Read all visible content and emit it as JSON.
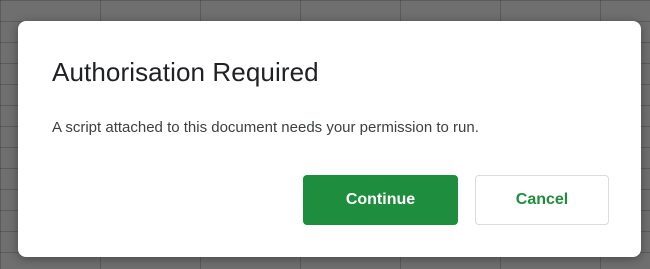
{
  "dialog": {
    "title": "Authorisation Required",
    "message": "A script attached to this document needs your permission to run.",
    "buttons": {
      "continue_label": "Continue",
      "cancel_label": "Cancel"
    }
  },
  "colors": {
    "primary_button": "#1e8e3e",
    "primary_button_text": "#ffffff",
    "secondary_button_text": "#1e8e3e",
    "backdrop": "#6f6f6f"
  }
}
